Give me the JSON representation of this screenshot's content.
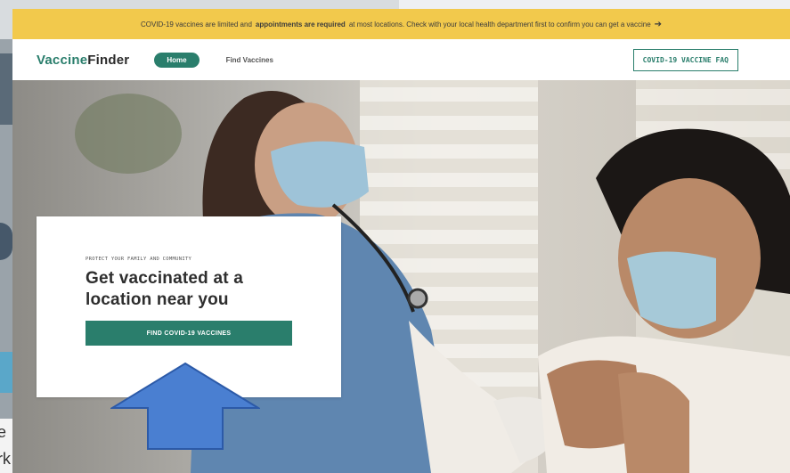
{
  "background_page": {
    "partial_text_lines": [
      "e",
      "rk"
    ]
  },
  "banner": {
    "text_before": "COVID-19 vaccines are limited and",
    "text_bold": "appointments are required",
    "text_after": "at most locations. Check with your local health department first to confirm you can get a vaccine",
    "arrow": "➔"
  },
  "nav": {
    "logo_part1": "Vaccine",
    "logo_part2": "Finder",
    "home_label": "Home",
    "find_label": "Find Vaccines",
    "faq_label": "COVID-19 VACCINE FAQ"
  },
  "hero_card": {
    "eyebrow": "PROTECT YOUR FAMILY AND COMMUNITY",
    "headline": "Get vaccinated at a location near you",
    "cta_label": "FIND COVID-19 VACCINES"
  },
  "annotation": {
    "arrow_direction": "up",
    "color": "#4a7fd1"
  },
  "colors": {
    "brand": "#2a7e6c",
    "banner": "#f2c94c"
  }
}
